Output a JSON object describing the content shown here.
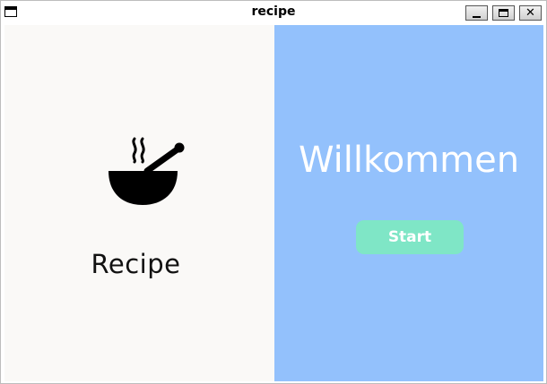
{
  "window": {
    "title": "recipe",
    "controls": {
      "minimize_glyph": "_",
      "maximize_glyph": "□",
      "close_glyph": "✕"
    }
  },
  "left_panel": {
    "logo_text": "Recipe",
    "icon": "bowl-with-spoon-icon"
  },
  "right_panel": {
    "welcome_text": "Willkommen",
    "start_label": "Start"
  },
  "colors": {
    "left_background": "#faf9f7",
    "right_background": "#93c1fc",
    "button_background": "#7fe6c6",
    "welcome_text": "#ffffff"
  }
}
